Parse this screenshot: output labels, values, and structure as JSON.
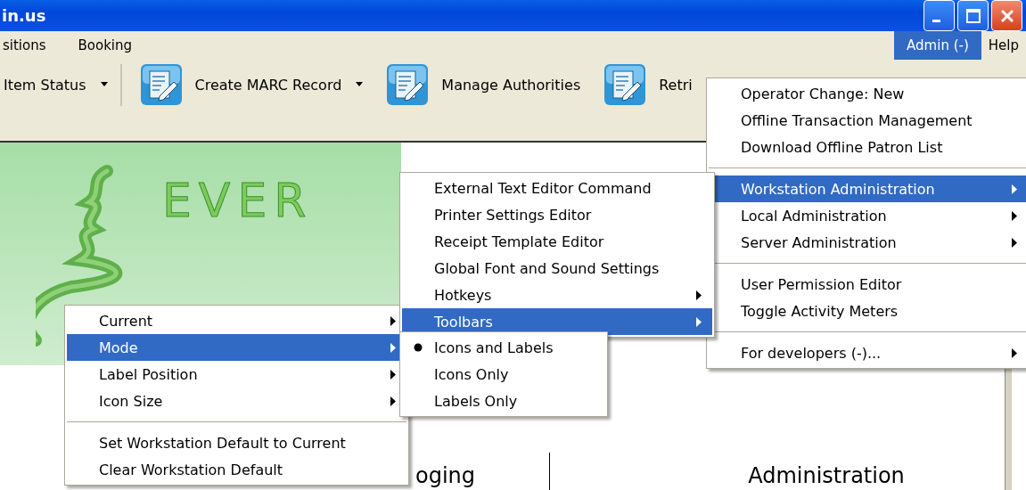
{
  "window": {
    "title": "in.us"
  },
  "menubar": {
    "left": [
      {
        "label": "sitions",
        "selected": false
      },
      {
        "label": "Booking",
        "selected": false
      }
    ],
    "right": [
      {
        "label": "Admin (-)",
        "selected": true
      },
      {
        "label": "Help",
        "selected": false
      }
    ]
  },
  "toolbar": [
    {
      "label": "Item Status",
      "icon": false,
      "dropdown": true,
      "separator_after": true
    },
    {
      "label": "Create MARC Record",
      "icon": true,
      "dropdown": true,
      "separator_after": false
    },
    {
      "label": "Manage Authorities",
      "icon": true,
      "dropdown": false,
      "separator_after": false
    },
    {
      "label": "Retri",
      "icon": true,
      "dropdown": false,
      "separator_after": false
    }
  ],
  "banner": {
    "logo_text": "EVER"
  },
  "bottom_tabs": [
    {
      "label": "oging"
    },
    {
      "label": "Administration"
    }
  ],
  "toolbar_context_menu": {
    "groups": [
      [
        {
          "label": "Current",
          "selected": false,
          "submenu": true
        },
        {
          "label": "Mode",
          "selected": true,
          "submenu": true
        },
        {
          "label": "Label Position",
          "selected": false,
          "submenu": true
        },
        {
          "label": "Icon Size",
          "selected": false,
          "submenu": true
        }
      ],
      [
        {
          "label": "Set Workstation Default to Current",
          "selected": false,
          "submenu": false
        },
        {
          "label": "Clear Workstation Default",
          "selected": false,
          "submenu": false
        }
      ]
    ]
  },
  "admin_menu": {
    "groups": [
      [
        {
          "label": "Operator Change: New",
          "selected": false,
          "submenu": false
        },
        {
          "label": "Offline Transaction Management",
          "selected": false,
          "submenu": false
        },
        {
          "label": "Download Offline Patron List",
          "selected": false,
          "submenu": false
        }
      ],
      [
        {
          "label": "Workstation Administration",
          "selected": true,
          "submenu": true
        },
        {
          "label": "Local Administration",
          "selected": false,
          "submenu": true
        },
        {
          "label": "Server Administration",
          "selected": false,
          "submenu": true
        }
      ],
      [
        {
          "label": "User Permission Editor",
          "selected": false,
          "submenu": false
        },
        {
          "label": "Toggle Activity Meters",
          "selected": false,
          "submenu": false
        }
      ],
      [
        {
          "label": "For developers (-)...",
          "selected": false,
          "submenu": true
        }
      ]
    ]
  },
  "workstation_menu": {
    "groups": [
      [
        {
          "label": "External Text Editor Command",
          "selected": false,
          "submenu": false
        },
        {
          "label": "Printer Settings Editor",
          "selected": false,
          "submenu": false
        },
        {
          "label": "Receipt Template Editor",
          "selected": false,
          "submenu": false
        },
        {
          "label": "Global Font and Sound Settings",
          "selected": false,
          "submenu": false
        },
        {
          "label": "Hotkeys",
          "selected": false,
          "submenu": true
        },
        {
          "label": "Toolbars",
          "selected": true,
          "submenu": true
        }
      ]
    ]
  },
  "toolbars_menu": {
    "groups": [
      [
        {
          "label": "Icons and Labels",
          "selected": false,
          "submenu": false,
          "checked": true
        },
        {
          "label": "Icons Only",
          "selected": false,
          "submenu": false,
          "checked": false
        },
        {
          "label": "Labels Only",
          "selected": false,
          "submenu": false,
          "checked": false
        }
      ]
    ]
  }
}
